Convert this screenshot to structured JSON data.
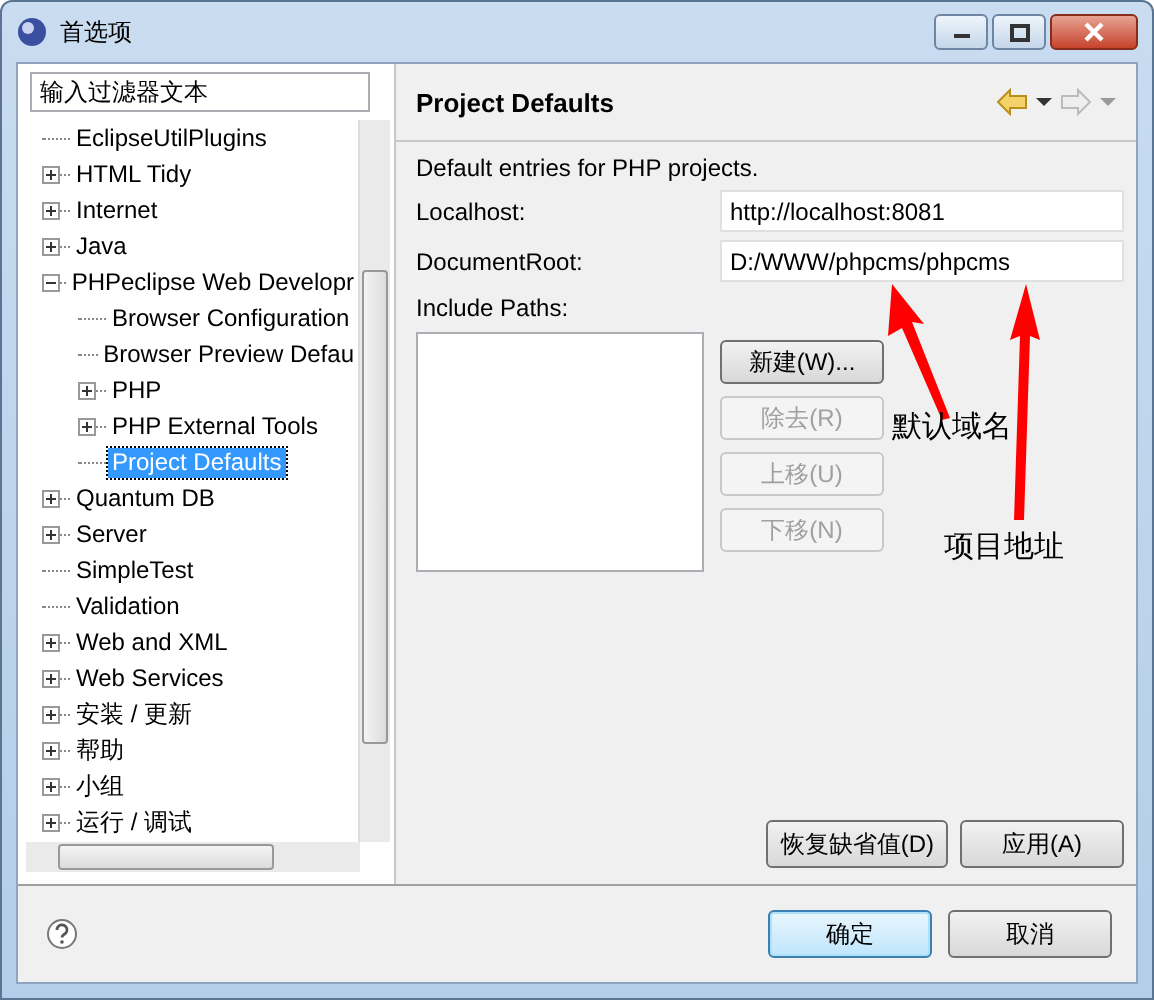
{
  "window": {
    "title": "首选项"
  },
  "filter": {
    "placeholder": "输入过滤器文本"
  },
  "tree": [
    {
      "label": "EclipseUtilPlugins",
      "kind": "leaf",
      "selected": false
    },
    {
      "label": "HTML Tidy",
      "kind": "folder",
      "expanded": false,
      "selected": false
    },
    {
      "label": "Internet",
      "kind": "folder",
      "expanded": false,
      "selected": false
    },
    {
      "label": "Java",
      "kind": "folder",
      "expanded": false,
      "selected": false
    },
    {
      "label": "PHPeclipse Web Developr",
      "kind": "folder",
      "expanded": true,
      "selected": false,
      "children": [
        {
          "label": "Browser Configuration",
          "kind": "leaf",
          "selected": false
        },
        {
          "label": "Browser Preview Defau",
          "kind": "leaf",
          "selected": false
        },
        {
          "label": "PHP",
          "kind": "folder",
          "expanded": false,
          "selected": false
        },
        {
          "label": "PHP External Tools",
          "kind": "folder",
          "expanded": false,
          "selected": false
        },
        {
          "label": "Project Defaults",
          "kind": "leaf",
          "selected": true
        }
      ]
    },
    {
      "label": "Quantum DB",
      "kind": "folder",
      "expanded": false,
      "selected": false
    },
    {
      "label": "Server",
      "kind": "folder",
      "expanded": false,
      "selected": false
    },
    {
      "label": "SimpleTest",
      "kind": "leaf",
      "selected": false
    },
    {
      "label": "Validation",
      "kind": "leaf",
      "selected": false
    },
    {
      "label": "Web and XML",
      "kind": "folder",
      "expanded": false,
      "selected": false
    },
    {
      "label": "Web Services",
      "kind": "folder",
      "expanded": false,
      "selected": false
    },
    {
      "label": "安装 / 更新",
      "kind": "folder",
      "expanded": false,
      "selected": false
    },
    {
      "label": "帮助",
      "kind": "folder",
      "expanded": false,
      "selected": false
    },
    {
      "label": "小组",
      "kind": "folder",
      "expanded": false,
      "selected": false
    },
    {
      "label": "运行 / 调试",
      "kind": "folder",
      "expanded": false,
      "selected": false
    }
  ],
  "page": {
    "title": "Project Defaults",
    "description": "Default entries for PHP projects.",
    "fields": [
      {
        "label": "Localhost:",
        "value": "http://localhost:8081"
      },
      {
        "label": "DocumentRoot:",
        "value": "D:/WWW/phpcms/phpcms"
      }
    ],
    "include_paths": {
      "label": "Include Paths:",
      "buttons": [
        {
          "label": "新建(W)...",
          "disabled": false
        },
        {
          "label": "除去(R)",
          "disabled": true
        },
        {
          "label": "上移(U)",
          "disabled": true
        },
        {
          "label": "下移(N)",
          "disabled": true
        }
      ]
    },
    "page_buttons": [
      "恢复缺省值(D)",
      "应用(A)"
    ]
  },
  "annotations": [
    {
      "text": "默认域名"
    },
    {
      "text": "项目地址"
    }
  ],
  "dialog_buttons": [
    {
      "label": "确定",
      "default": true
    },
    {
      "label": "取消",
      "default": false
    }
  ]
}
